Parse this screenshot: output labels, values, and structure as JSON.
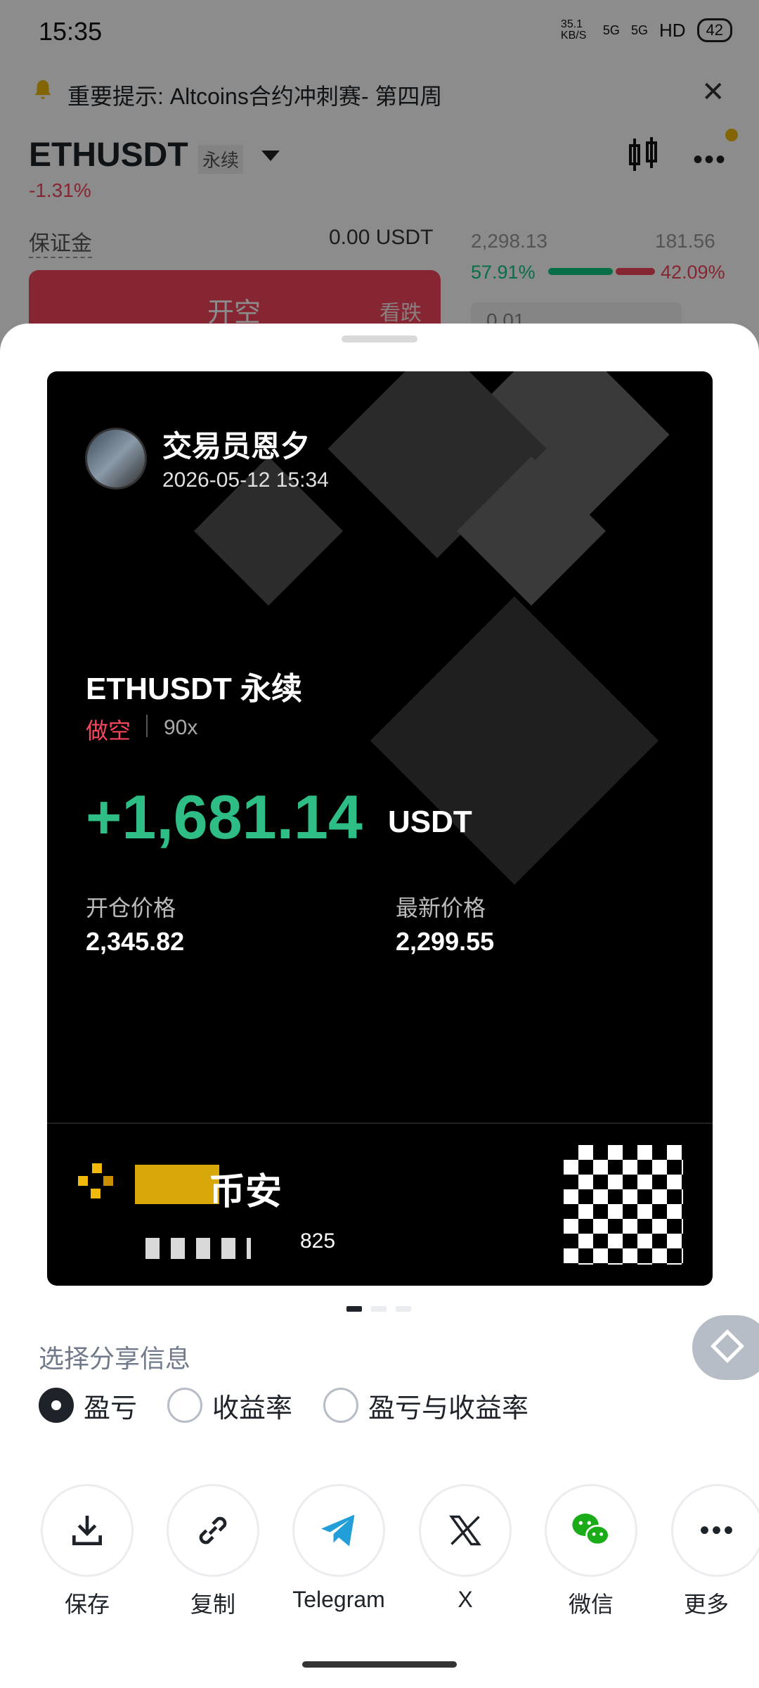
{
  "status_bar": {
    "time": "15:35",
    "net_speed": "35.1 KB/S",
    "indicators": [
      "5G",
      "5G",
      "HD"
    ],
    "battery": "42"
  },
  "notice": {
    "text": "重要提示: Altcoins合约冲刺赛- 第四周"
  },
  "trade_header": {
    "pair": "ETHUSDT",
    "contract_type": "永续",
    "change": "-1.31%",
    "margin_label": "保证金",
    "margin_value": "0.00 USDT",
    "book_left": "2,298.13",
    "book_right": "181.56",
    "ratio_long": "57.91%",
    "ratio_short": "42.09%",
    "short_button": "开空",
    "short_sub": "看跌",
    "qty_placeholder": "0.01"
  },
  "share_card": {
    "trader_name": "交易员恩夕",
    "timestamp": "2026-05-12 15:34",
    "pair_line": "ETHUSDT 永续",
    "side": "做空",
    "leverage": "90x",
    "pnl": "+1,681.14",
    "pnl_unit": "USDT",
    "entry_label": "开仓价格",
    "entry_value": "2,345.82",
    "last_label": "最新价格",
    "last_value": "2,299.55",
    "brand_text": "币安",
    "referral_suffix": "825",
    "page_index": 1,
    "page_count": 3
  },
  "share_options": {
    "title": "选择分享信息",
    "options": [
      {
        "label": "盈亏",
        "selected": true
      },
      {
        "label": "收益率",
        "selected": false
      },
      {
        "label": "盈亏与收益率",
        "selected": false
      }
    ]
  },
  "share_targets": [
    {
      "label": "保存",
      "icon": "download-icon"
    },
    {
      "label": "复制",
      "icon": "link-icon"
    },
    {
      "label": "Telegram",
      "icon": "telegram-icon"
    },
    {
      "label": "X",
      "icon": "x-logo-icon"
    },
    {
      "label": "微信",
      "icon": "wechat-icon"
    },
    {
      "label": "更多",
      "icon": "more-icon"
    }
  ],
  "colors": {
    "up": "#2ebd85",
    "down": "#f6465d",
    "brand": "#f0b90b"
  }
}
